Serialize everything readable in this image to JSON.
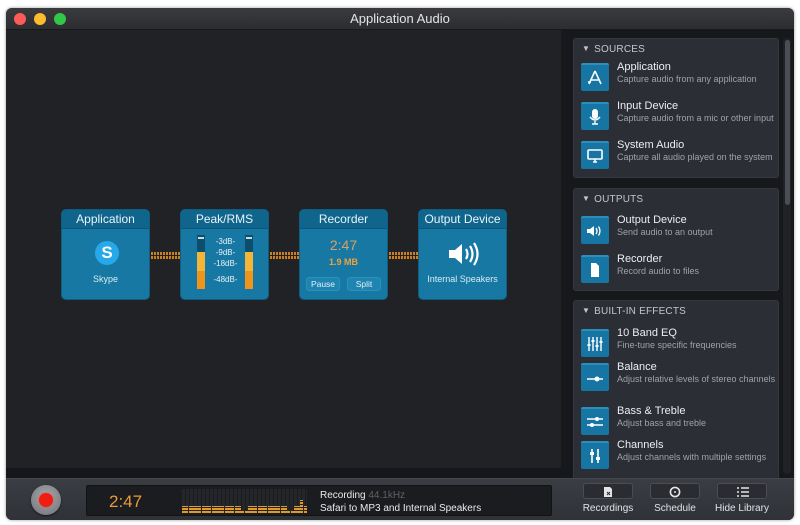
{
  "window": {
    "title": "Application Audio"
  },
  "pipeline": {
    "nodes": [
      {
        "title": "Application",
        "caption": "Skype",
        "icon": "skype-icon"
      },
      {
        "title": "Peak/RMS",
        "meter_labels": [
          "-3dB-",
          "-9dB-",
          "-18dB-",
          "-48dB-"
        ],
        "left_level": 0.65,
        "right_level": 0.65
      },
      {
        "title": "Recorder",
        "time": "2:47",
        "size": "1.9 MB",
        "pause_label": "Pause",
        "split_label": "Split"
      },
      {
        "title": "Output Device",
        "caption": "Internal Speakers",
        "icon": "speaker-icon"
      }
    ]
  },
  "library": {
    "sections": [
      {
        "heading": "SOURCES",
        "items": [
          {
            "title": "Application",
            "desc": "Capture audio from any application",
            "icon": "app-store-icon"
          },
          {
            "title": "Input Device",
            "desc": "Capture audio from a mic or other input",
            "icon": "microphone-icon"
          },
          {
            "title": "System Audio",
            "desc": "Capture all audio played on the system",
            "icon": "monitor-icon"
          }
        ]
      },
      {
        "heading": "OUTPUTS",
        "items": [
          {
            "title": "Output Device",
            "desc": "Send audio to an output",
            "icon": "speaker-icon"
          },
          {
            "title": "Recorder",
            "desc": "Record audio to files",
            "icon": "document-icon"
          }
        ]
      },
      {
        "heading": "BUILT-IN EFFECTS",
        "items": [
          {
            "title": "10 Band EQ",
            "desc": "Fine-tune specific frequencies",
            "icon": "eq-sliders-icon"
          },
          {
            "title": "Balance",
            "desc": "Adjust relative levels of stereo channels",
            "icon": "balance-icon"
          },
          {
            "title": "Bass & Treble",
            "desc": "Adjust bass and treble",
            "icon": "bass-treble-icon"
          },
          {
            "title": "Channels",
            "desc": "Adjust channels with multiple settings",
            "icon": "channels-icon"
          }
        ]
      }
    ]
  },
  "status": {
    "time": "2:47",
    "state": "Recording",
    "sample_rate": "44.1kHz",
    "description": "Safari to MP3 and Internal Speakers",
    "vu_levels": [
      0.3,
      0.3,
      0.3,
      0.3,
      0.3,
      0.3,
      0.3,
      0.3,
      0.3,
      0.3,
      0.3,
      0.3,
      0.3,
      0.3,
      0.3,
      0.3,
      0.3,
      0.3,
      0.1,
      0.1,
      0.3,
      0.3,
      0.3,
      0.3,
      0.3,
      0.3,
      0.3,
      0.3,
      0.3,
      0.3,
      0.3,
      0.3,
      0.1,
      0.1,
      0.3,
      0.3,
      0.55,
      0.3
    ]
  },
  "toolbar": {
    "recordings_label": "Recordings",
    "schedule_label": "Schedule",
    "hide_library_label": "Hide Library"
  },
  "colors": {
    "accent_blue": "#1778a3",
    "accent_orange": "#eb9a34",
    "record_red": "#f01d12"
  }
}
